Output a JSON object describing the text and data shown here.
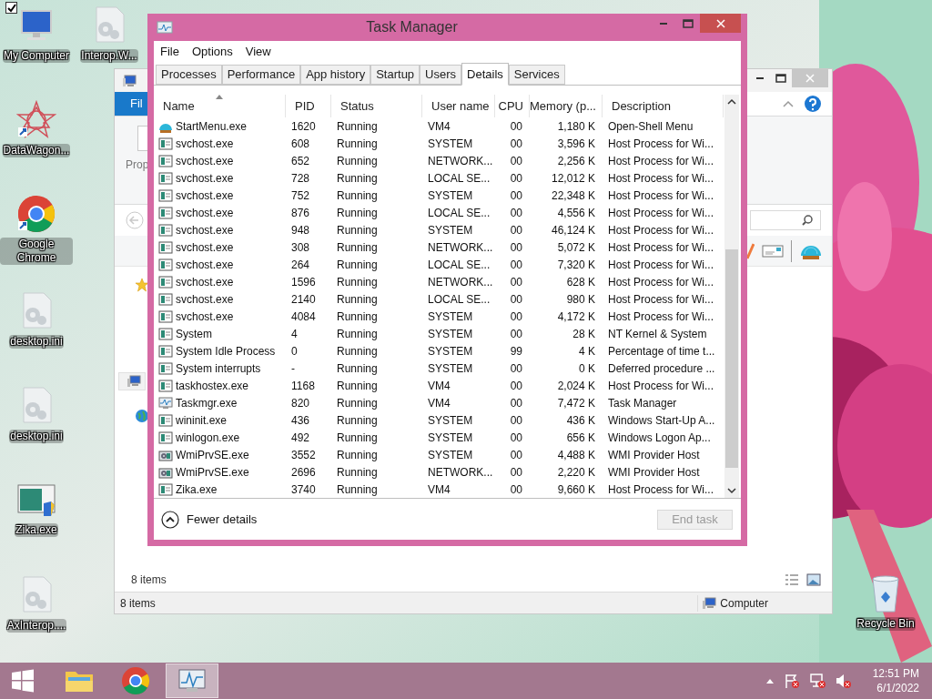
{
  "desktop_icons": [
    {
      "label": "My Computer",
      "kind": "computer",
      "checked": true
    },
    {
      "label": "Interop.W...",
      "kind": "file"
    },
    {
      "label": "DataWagon...",
      "kind": "star"
    },
    {
      "label": "Google Chrome",
      "kind": "chrome"
    },
    {
      "label": "desktop.ini",
      "kind": "file"
    },
    {
      "label": "desktop.ini",
      "kind": "file"
    },
    {
      "label": "Zika.exe",
      "kind": "exe"
    },
    {
      "label": "AxInterop....",
      "kind": "file"
    },
    {
      "label": "Recycle Bin",
      "kind": "bin"
    }
  ],
  "explorer": {
    "ribbon_tab": "Fil",
    "ribbon_label": "Prop",
    "item_count": "8 items",
    "status_count": "8 items",
    "status_location": "Computer"
  },
  "task_manager": {
    "title": "Task Manager",
    "menu": [
      "File",
      "Options",
      "View"
    ],
    "tabs": [
      {
        "label": "Processes",
        "selected": false
      },
      {
        "label": "Performance",
        "selected": false
      },
      {
        "label": "App history",
        "selected": false
      },
      {
        "label": "Startup",
        "selected": false
      },
      {
        "label": "Users",
        "selected": false
      },
      {
        "label": "Details",
        "selected": true
      },
      {
        "label": "Services",
        "selected": false
      }
    ],
    "columns": [
      {
        "label": "Name",
        "sorted": true
      },
      {
        "label": "PID",
        "sorted": false
      },
      {
        "label": "Status",
        "sorted": false
      },
      {
        "label": "User name",
        "sorted": false
      },
      {
        "label": "CPU",
        "sorted": false
      },
      {
        "label": "Memory (p...",
        "sorted": false
      },
      {
        "label": "Description",
        "sorted": false
      }
    ],
    "rows": [
      {
        "kind": "shell",
        "name": "StartMenu.exe",
        "pid": "1620",
        "status": "Running",
        "user": "VM4",
        "cpu": "00",
        "memory": "1,180 K",
        "description": "Open-Shell Menu"
      },
      {
        "kind": "service",
        "name": "svchost.exe",
        "pid": "608",
        "status": "Running",
        "user": "SYSTEM",
        "cpu": "00",
        "memory": "3,596 K",
        "description": "Host Process for Wi..."
      },
      {
        "kind": "service",
        "name": "svchost.exe",
        "pid": "652",
        "status": "Running",
        "user": "NETWORK...",
        "cpu": "00",
        "memory": "2,256 K",
        "description": "Host Process for Wi..."
      },
      {
        "kind": "service",
        "name": "svchost.exe",
        "pid": "728",
        "status": "Running",
        "user": "LOCAL SE...",
        "cpu": "00",
        "memory": "12,012 K",
        "description": "Host Process for Wi..."
      },
      {
        "kind": "service",
        "name": "svchost.exe",
        "pid": "752",
        "status": "Running",
        "user": "SYSTEM",
        "cpu": "00",
        "memory": "22,348 K",
        "description": "Host Process for Wi..."
      },
      {
        "kind": "service",
        "name": "svchost.exe",
        "pid": "876",
        "status": "Running",
        "user": "LOCAL SE...",
        "cpu": "00",
        "memory": "4,556 K",
        "description": "Host Process for Wi..."
      },
      {
        "kind": "service",
        "name": "svchost.exe",
        "pid": "948",
        "status": "Running",
        "user": "SYSTEM",
        "cpu": "00",
        "memory": "46,124 K",
        "description": "Host Process for Wi..."
      },
      {
        "kind": "service",
        "name": "svchost.exe",
        "pid": "308",
        "status": "Running",
        "user": "NETWORK...",
        "cpu": "00",
        "memory": "5,072 K",
        "description": "Host Process for Wi..."
      },
      {
        "kind": "service",
        "name": "svchost.exe",
        "pid": "264",
        "status": "Running",
        "user": "LOCAL SE...",
        "cpu": "00",
        "memory": "7,320 K",
        "description": "Host Process for Wi..."
      },
      {
        "kind": "service",
        "name": "svchost.exe",
        "pid": "1596",
        "status": "Running",
        "user": "NETWORK...",
        "cpu": "00",
        "memory": "628 K",
        "description": "Host Process for Wi..."
      },
      {
        "kind": "service",
        "name": "svchost.exe",
        "pid": "2140",
        "status": "Running",
        "user": "LOCAL SE...",
        "cpu": "00",
        "memory": "980 K",
        "description": "Host Process for Wi..."
      },
      {
        "kind": "service",
        "name": "svchost.exe",
        "pid": "4084",
        "status": "Running",
        "user": "SYSTEM",
        "cpu": "00",
        "memory": "4,172 K",
        "description": "Host Process for Wi..."
      },
      {
        "kind": "service",
        "name": "System",
        "pid": "4",
        "status": "Running",
        "user": "SYSTEM",
        "cpu": "00",
        "memory": "28 K",
        "description": "NT Kernel & System"
      },
      {
        "kind": "service",
        "name": "System Idle Process",
        "pid": "0",
        "status": "Running",
        "user": "SYSTEM",
        "cpu": "99",
        "memory": "4 K",
        "description": "Percentage of time t..."
      },
      {
        "kind": "service",
        "name": "System interrupts",
        "pid": "-",
        "status": "Running",
        "user": "SYSTEM",
        "cpu": "00",
        "memory": "0 K",
        "description": "Deferred procedure ..."
      },
      {
        "kind": "service",
        "name": "taskhostex.exe",
        "pid": "1168",
        "status": "Running",
        "user": "VM4",
        "cpu": "00",
        "memory": "2,024 K",
        "description": "Host Process for Wi..."
      },
      {
        "kind": "monitor",
        "name": "Taskmgr.exe",
        "pid": "820",
        "status": "Running",
        "user": "VM4",
        "cpu": "00",
        "memory": "7,472 K",
        "description": "Task Manager"
      },
      {
        "kind": "service",
        "name": "wininit.exe",
        "pid": "436",
        "status": "Running",
        "user": "SYSTEM",
        "cpu": "00",
        "memory": "436 K",
        "description": "Windows Start-Up A..."
      },
      {
        "kind": "service",
        "name": "winlogon.exe",
        "pid": "492",
        "status": "Running",
        "user": "SYSTEM",
        "cpu": "00",
        "memory": "656 K",
        "description": "Windows Logon Ap..."
      },
      {
        "kind": "wmi",
        "name": "WmiPrvSE.exe",
        "pid": "3552",
        "status": "Running",
        "user": "SYSTEM",
        "cpu": "00",
        "memory": "4,488 K",
        "description": "WMI Provider Host"
      },
      {
        "kind": "wmi",
        "name": "WmiPrvSE.exe",
        "pid": "2696",
        "status": "Running",
        "user": "NETWORK...",
        "cpu": "00",
        "memory": "2,220 K",
        "description": "WMI Provider Host"
      },
      {
        "kind": "service",
        "name": "Zika.exe",
        "pid": "3740",
        "status": "Running",
        "user": "VM4",
        "cpu": "00",
        "memory": "9,660 K",
        "description": "Host Process for Wi..."
      }
    ],
    "fewer_details": "Fewer details",
    "end_task": {
      "label": "End task",
      "disabled": true
    }
  },
  "taskbar": {
    "apps": [
      {
        "kind": "explorer",
        "selected": false
      },
      {
        "kind": "chrome",
        "selected": false
      },
      {
        "kind": "monitor",
        "selected": true
      }
    ],
    "time": "12:51 PM",
    "date": "6/1/2022"
  }
}
